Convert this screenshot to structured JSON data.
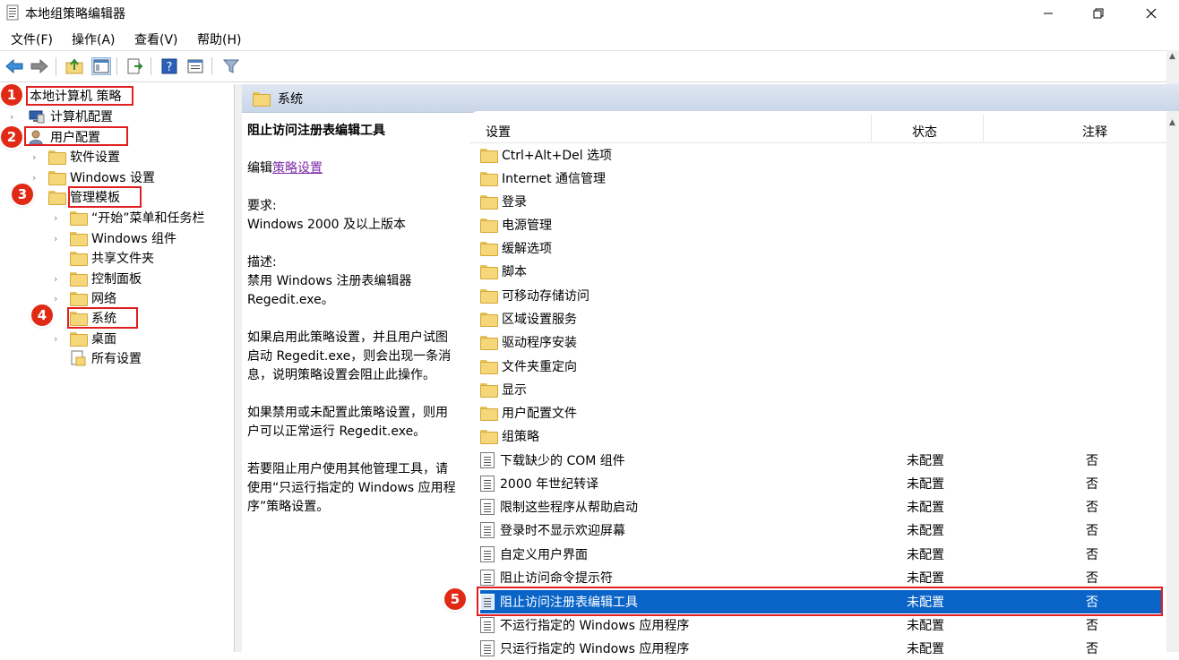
{
  "window": {
    "title": "本地组策略编辑器"
  },
  "menu": [
    "文件(F)",
    "操作(A)",
    "查看(V)",
    "帮助(H)"
  ],
  "tree": {
    "root": "本地计算机 策略",
    "computer_config": "计算机配置",
    "user_config": "用户配置",
    "software_settings": "软件设置",
    "windows_settings": "Windows 设置",
    "admin_templates": "管理模板",
    "start_menu": "“开始”菜单和任务栏",
    "windows_components": "Windows 组件",
    "shared_folders": "共享文件夹",
    "control_panel": "控制面板",
    "network": "网络",
    "system": "系统",
    "desktop": "桌面",
    "all_settings": "所有设置"
  },
  "badges": [
    "1",
    "2",
    "3",
    "4",
    "5"
  ],
  "right_header": "系统",
  "description": {
    "title": "阻止访问注册表编辑工具",
    "edit_prefix": "编辑",
    "edit_link": "策略设置",
    "requirements_label": "要求:",
    "requirements": "Windows 2000 及以上版本",
    "desc_label": "描述:",
    "desc_line1": "禁用 Windows 注册表编辑器",
    "desc_line2": "Regedit.exe。",
    "para1_l1": "如果启用此策略设置，并且用户试图",
    "para1_l2": "启动 Regedit.exe，则会出现一条消",
    "para1_l3": "息，说明策略设置会阻止此操作。",
    "para2_l1": "如果禁用或未配置此策略设置，则用",
    "para2_l2": "户可以正常运行 Regedit.exe。",
    "para3_l1": "若要阻止用户使用其他管理工具，请",
    "para3_l2": "使用“只运行指定的 Windows 应用程",
    "para3_l3": "序”策略设置。"
  },
  "columns": {
    "setting": "设置",
    "state": "状态",
    "comment": "注释"
  },
  "folders": [
    "Ctrl+Alt+Del 选项",
    "Internet 通信管理",
    "登录",
    "电源管理",
    "缓解选项",
    "脚本",
    "可移动存储访问",
    "区域设置服务",
    "驱动程序安装",
    "文件夹重定向",
    "显示",
    "用户配置文件",
    "组策略"
  ],
  "policies": [
    {
      "name": "下载缺少的 COM 组件",
      "state": "未配置",
      "comment": "否"
    },
    {
      "name": "2000 年世纪转译",
      "state": "未配置",
      "comment": "否"
    },
    {
      "name": "限制这些程序从帮助启动",
      "state": "未配置",
      "comment": "否"
    },
    {
      "name": "登录时不显示欢迎屏幕",
      "state": "未配置",
      "comment": "否"
    },
    {
      "name": "自定义用户界面",
      "state": "未配置",
      "comment": "否"
    },
    {
      "name": "阻止访问命令提示符",
      "state": "未配置",
      "comment": "否"
    },
    {
      "name": "阻止访问注册表编辑工具",
      "state": "未配置",
      "comment": "否"
    },
    {
      "name": "不运行指定的 Windows 应用程序",
      "state": "未配置",
      "comment": "否"
    },
    {
      "name": "只运行指定的 Windows 应用程序",
      "state": "未配置",
      "comment": "否"
    }
  ],
  "colors": {
    "selection": "#0a64c8",
    "annotation_red": "#e02020",
    "header_blue": "#c9d6e8"
  }
}
